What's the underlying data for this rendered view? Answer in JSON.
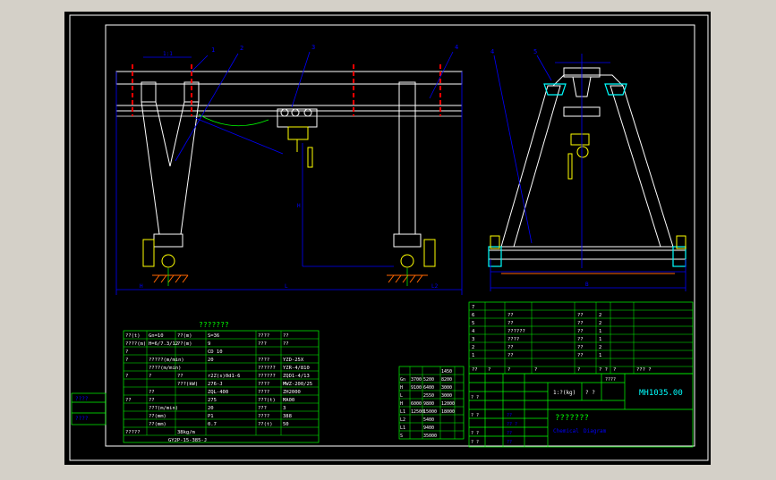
{
  "colors": {
    "background": "#d4d0c8",
    "paper": "#000000",
    "frame": "#ffffff",
    "table": "#00ff00",
    "dimension": "#0000ff",
    "structure": "#ffffff",
    "centerline": "#ff0000",
    "hatch": "#ff6600",
    "motor": "#ffff00",
    "text": "#ffffff"
  },
  "callouts": {
    "front": [
      "1",
      "2",
      "3",
      "4"
    ],
    "side": [
      "4",
      "5"
    ]
  },
  "front_dims": {
    "top": "1:1",
    "left": "H",
    "mid": "L",
    "right": "L2",
    "height": "H"
  },
  "side_dims": {
    "bottom": "B"
  },
  "tech_table": {
    "title": "???????",
    "rows": [
      [
        "??(t)",
        "Gn=10",
        "??(m)",
        "S=36",
        "????",
        "??"
      ],
      [
        "????(m)",
        "H=6/7.3/12",
        "??(m)",
        "9",
        "???",
        "??"
      ],
      [
        "?",
        "",
        "",
        "CD 10",
        "",
        ""
      ],
      [
        "?",
        "?????(m/min)",
        "",
        "20",
        "????",
        "YZD-25X"
      ],
      [
        "",
        "????(m/min)",
        "",
        "",
        "??????",
        "YZR-4/810"
      ],
      [
        "?",
        "?",
        "??",
        "r2Z(s)0d1-6",
        "??????",
        "ZQD1-4/13"
      ],
      [
        "",
        "",
        "???(kW)",
        "276-J",
        "????",
        "MWZ-200/25"
      ],
      [
        "",
        "??",
        "",
        "ZQL-400",
        "????",
        "ZH2000"
      ],
      [
        "??",
        "??",
        "",
        "275",
        "???(t)",
        "MA00"
      ],
      [
        "",
        "???(m/min)",
        "",
        "20",
        "???",
        "3"
      ],
      [
        "",
        "??(mm)",
        "",
        "P1",
        "????",
        "388"
      ],
      [
        "",
        "??(mm)",
        "",
        "0.7",
        "??(t)",
        "50"
      ],
      [
        "?????",
        "",
        "38kg/m",
        "",
        "",
        ""
      ]
    ],
    "footer": "GY2P-15-385-J"
  },
  "dim_table": {
    "header": [
      "",
      "1450"
    ],
    "rows": [
      [
        "Gn",
        "3700",
        "5200",
        "8200"
      ],
      [
        "H",
        "9100",
        "6400",
        "3000"
      ],
      [
        "L",
        "",
        "2550",
        "3000"
      ],
      [
        "H",
        "6000",
        "9800",
        "12000"
      ],
      [
        "L1",
        "12500",
        "15000",
        "18000"
      ],
      [
        "L2",
        "",
        "5400",
        ""
      ],
      [
        "L1",
        "",
        "9400",
        ""
      ],
      [
        "S",
        "",
        "35000",
        ""
      ]
    ]
  },
  "side_labels": {
    "a": "????",
    "b": "????"
  },
  "parts_list": {
    "rows": [
      [
        "7",
        "",
        "",
        "",
        "",
        "",
        ""
      ],
      [
        "6",
        "",
        "??",
        "",
        "??",
        "2",
        ""
      ],
      [
        "5",
        "",
        "??",
        "",
        "??",
        "2",
        ""
      ],
      [
        "4",
        "",
        "??????",
        "",
        "??",
        "1",
        ""
      ],
      [
        "3",
        "",
        "????",
        "",
        "??",
        "1",
        ""
      ],
      [
        "2",
        "",
        "??",
        "",
        "??",
        "2",
        ""
      ],
      [
        "1",
        "",
        "??",
        "",
        "??",
        "1",
        ""
      ]
    ],
    "header": [
      "??",
      "?",
      "?",
      "?",
      "?",
      "? ?",
      "?",
      "??? ?"
    ]
  },
  "title_block": {
    "drawing_no": "MH1035.00",
    "name": "???????",
    "scale": "1:?(kg)",
    "sheet": "? ?",
    "company1": "Chemical",
    "company2": "Diagram",
    "row_labels": [
      "? ?",
      "? ?",
      "? ?",
      "? ?"
    ],
    "small": [
      "??",
      "?? ?",
      "??",
      "??",
      "????"
    ]
  },
  "side_note": {
    "a": "????",
    "b": "????"
  }
}
